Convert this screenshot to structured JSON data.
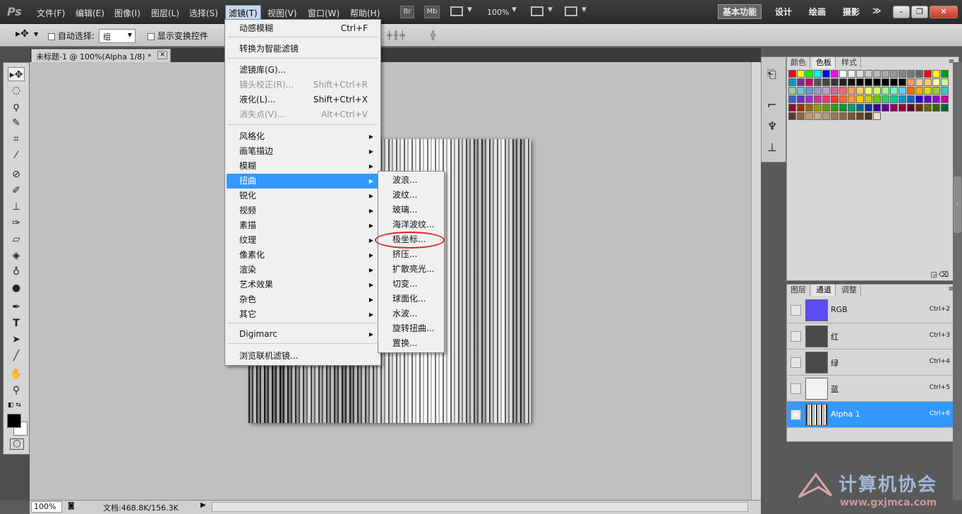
{
  "app": {
    "logo": "Ps"
  },
  "menubar": {
    "items": [
      "文件(F)",
      "编辑(E)",
      "图像(I)",
      "图层(L)",
      "选择(S)",
      "滤镜(T)",
      "视图(V)",
      "窗口(W)",
      "帮助(H)"
    ],
    "active_index": 5,
    "br": "Br",
    "mb": "Mb",
    "zoom": "100%"
  },
  "workspaces": {
    "items": [
      "基本功能",
      "设计",
      "绘画",
      "摄影"
    ],
    "active": "基本功能",
    "more": "≫"
  },
  "window_buttons": {
    "min": "–",
    "restore": "❐",
    "close": "✕"
  },
  "options": {
    "auto_select_label": "自动选择:",
    "auto_select_value": "组",
    "show_transform_label": "显示变换控件"
  },
  "document": {
    "tab_title": "未标题-1 @ 100%(Alpha 1/8) *",
    "tab_close": "✕"
  },
  "filter_menu": {
    "items": [
      {
        "label": "动感模糊",
        "shortcut": "Ctrl+F"
      },
      {
        "label": "转换为智能滤镜"
      },
      {
        "label": "滤镜库(G)..."
      },
      {
        "label": "镜头校正(R)...",
        "shortcut": "Shift+Ctrl+R",
        "disabled": true
      },
      {
        "label": "液化(L)...",
        "shortcut": "Shift+Ctrl+X"
      },
      {
        "label": "消失点(V)...",
        "shortcut": "Alt+Ctrl+V",
        "disabled": true
      },
      {
        "label": "风格化",
        "submenu": true
      },
      {
        "label": "画笔描边",
        "submenu": true
      },
      {
        "label": "模糊",
        "submenu": true
      },
      {
        "label": "扭曲",
        "submenu": true,
        "highlighted": true
      },
      {
        "label": "锐化",
        "submenu": true
      },
      {
        "label": "视频",
        "submenu": true
      },
      {
        "label": "素描",
        "submenu": true
      },
      {
        "label": "纹理",
        "submenu": true
      },
      {
        "label": "像素化",
        "submenu": true
      },
      {
        "label": "渲染",
        "submenu": true
      },
      {
        "label": "艺术效果",
        "submenu": true
      },
      {
        "label": "杂色",
        "submenu": true
      },
      {
        "label": "其它",
        "submenu": true
      },
      {
        "label": "Digimarc",
        "submenu": true
      },
      {
        "label": "浏览联机滤镜..."
      }
    ]
  },
  "distort_submenu": {
    "items": [
      "波浪...",
      "波纹...",
      "玻璃...",
      "海洋波纹...",
      "极坐标...",
      "挤压...",
      "扩散亮光...",
      "切变...",
      "球面化...",
      "水波...",
      "旋转扭曲...",
      "置换..."
    ],
    "circled": "极坐标..."
  },
  "swatches_panel": {
    "tabs": [
      "颜色",
      "色板",
      "样式"
    ],
    "active": "色板"
  },
  "channels_panel": {
    "tabs": [
      "图层",
      "通道",
      "调整"
    ],
    "active": "通道",
    "channels": [
      {
        "name": "RGB",
        "shortcut": "Ctrl+2",
        "color": "#5b4cf5"
      },
      {
        "name": "红",
        "shortcut": "Ctrl+3",
        "color": "#4a4a4a"
      },
      {
        "name": "绿",
        "shortcut": "Ctrl+4",
        "color": "#4a4a4a"
      },
      {
        "name": "蓝",
        "shortcut": "Ctrl+5",
        "color": "#f2f2f2"
      },
      {
        "name": "Alpha 1",
        "shortcut": "Ctrl+6",
        "selected": true,
        "visible": true
      }
    ]
  },
  "status": {
    "zoom": "100%",
    "doc_size": "文档:468.8K/156.3K"
  },
  "watermark": {
    "text": "计算机协会",
    "url": "www.gxjmca.com"
  }
}
